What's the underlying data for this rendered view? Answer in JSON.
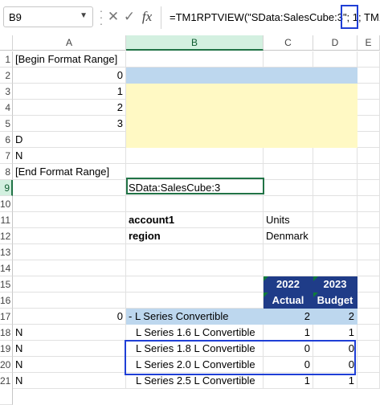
{
  "formula_bar": {
    "name_box": "B9",
    "cancel_icon": "✕",
    "enter_icon": "✓",
    "fx": "fx",
    "formula": "=TM1RPTVIEW(\"SData:SalesCube:3\"; 1; TM1"
  },
  "columns": [
    "A",
    "B",
    "C",
    "D",
    "E"
  ],
  "rows": [
    "1",
    "2",
    "3",
    "4",
    "5",
    "6",
    "7",
    "8",
    "9",
    "10",
    "11",
    "12",
    "13",
    "14",
    "15",
    "16",
    "17",
    "18",
    "19",
    "20",
    "21"
  ],
  "cells": {
    "a1": "[Begin Format Range]",
    "a2": "0",
    "a3": "1",
    "a4": "2",
    "a5": "3",
    "a6": "D",
    "a7": "N",
    "a8": "[End Format Range]",
    "b9": "SData:SalesCube:3",
    "b11": "account1",
    "c11": "Units",
    "b12": "region",
    "c12": "Denmark",
    "c15": "2022",
    "d15": "2023",
    "c16": "Actual",
    "d16": "Budget",
    "a17": "0",
    "b17": "- L Series Convertible",
    "c17": "2",
    "d17": "2",
    "a18": "N",
    "b18": "L Series 1.6 L Convertible",
    "c18": "1",
    "d18": "1",
    "a19": "N",
    "b19": "L Series 1.8 L Convertible",
    "c19": "0",
    "d19": "0",
    "a20": "N",
    "b20": "L Series 2.0 L Convertible",
    "c20": "0",
    "d20": "0",
    "a21": "N",
    "b21": "L Series 2.5 L Convertible",
    "c21": "1",
    "d21": "1"
  }
}
